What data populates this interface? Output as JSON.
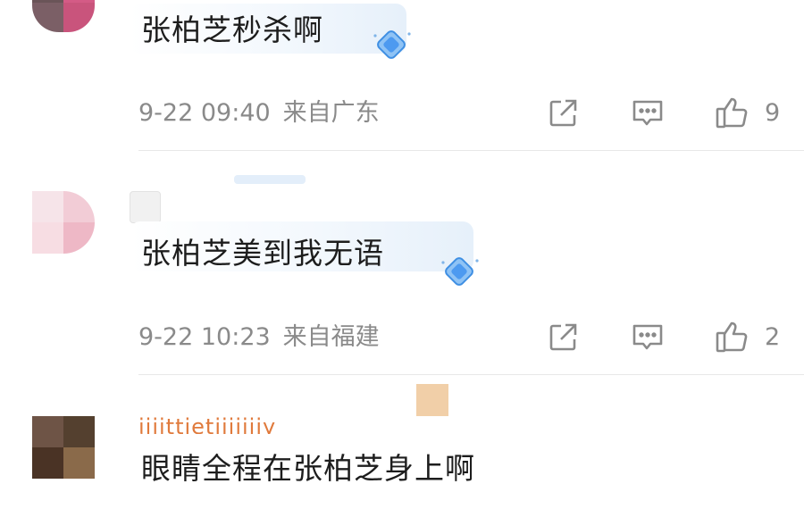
{
  "comments": [
    {
      "text": "张柏芝秒杀啊",
      "time": "9-22 09:40",
      "location": "来自广东",
      "likes": "9"
    },
    {
      "text": "张柏芝美到我无语",
      "time": "9-22 10:23",
      "location": "来自福建",
      "likes": "2"
    },
    {
      "nickname_partial": "iiiittietiiiiiiiy",
      "text": "眼睛全程在张柏芝身上啊"
    }
  ],
  "icons": {
    "share": "share-icon",
    "comment": "comment-icon",
    "like": "thumbs-up-icon",
    "badge": "diamond-badge-icon"
  }
}
